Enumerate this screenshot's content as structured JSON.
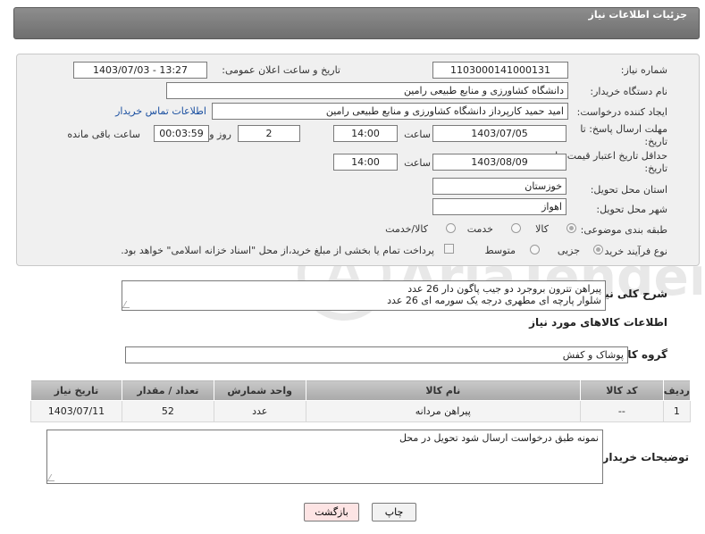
{
  "header": {
    "title": "جزئیات اطلاعات نیاز"
  },
  "form": {
    "need_number_label": "شماره نیاز:",
    "need_number": "1103000141000131",
    "announce_label": "تاریخ و ساعت اعلان عمومی:",
    "announce_value": "1403/07/03 - 13:27",
    "buyer_org_label": "نام دستگاه خریدار:",
    "buyer_org": "دانشگاه کشاورزی و منابع طبیعی رامین",
    "creator_label": "ایجاد کننده درخواست:",
    "creator": "امید حمید کارپرداز دانشگاه کشاورزی و منابع طبیعی رامین",
    "contact_link": "اطلاعات تماس خریدار",
    "reply_deadline_label": "مهلت ارسال پاسخ: تا تاریخ:",
    "reply_date": "1403/07/05",
    "time_label": "ساعت",
    "reply_time": "14:00",
    "days_value": "2",
    "days_label": "روز و",
    "remaining_value": "00:03:59",
    "remaining_label": "ساعت باقی مانده",
    "price_validity_label": "حداقل تاریخ اعتبار قیمت: تا تاریخ:",
    "price_date": "1403/08/09",
    "price_time": "14:00",
    "province_label": "استان محل تحویل:",
    "province": "خوزستان",
    "city_label": "شهر محل تحویل:",
    "city": "اهواز",
    "category_label": "طبقه بندی موضوعی:",
    "category_options": [
      "کالا",
      "خدمت",
      "کالا/خدمت"
    ],
    "process_label": "نوع فرآیند خرید :",
    "process_options": [
      "جزیی",
      "متوسط"
    ],
    "payment_note": "پرداخت تمام یا بخشی از مبلغ خرید،از محل \"اسناد خزانه اسلامی\" خواهد بود."
  },
  "description": {
    "label": "شرح کلی نیاز:",
    "line1": "پیراهن تترون بروجرد دو جیب پاگون دار 26 عدد",
    "line2": "شلوار پارچه ای مطهری درجه یک سورمه ای 26 عدد"
  },
  "goods": {
    "section_title": "اطلاعات کالاهای مورد نیاز",
    "group_label": "گروه کالا:",
    "group_value": "پوشاک و کفش",
    "columns": [
      "ردیف",
      "کد کالا",
      "نام کالا",
      "واحد شمارش",
      "تعداد / مقدار",
      "تاریخ نیاز"
    ],
    "rows": [
      [
        "1",
        "--",
        "پیراهن مردانه",
        "عدد",
        "52",
        "1403/07/11"
      ]
    ]
  },
  "buyer_notes": {
    "label": "توضیحات خریدار:",
    "text": "نمونه طبق درخواست ارسال شود تحویل در محل"
  },
  "buttons": {
    "print": "چاپ",
    "back": "بازگشت"
  },
  "watermark": {
    "text": "AriaTender.neT"
  }
}
